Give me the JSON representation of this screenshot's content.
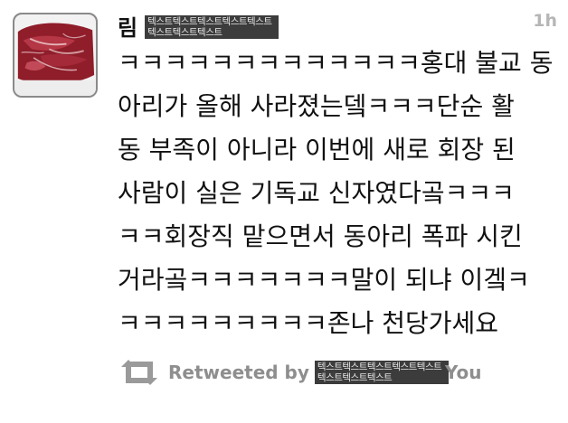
{
  "tweet": {
    "author": {
      "display_name": "림",
      "redacted_handle": "텍스트텍스트텍스트텍스트텍스트텍스트텍스트텍스트"
    },
    "timestamp": "1h",
    "text_lines": [
      "ㅋㅋㅋㅋㅋㅋㅋㅋㅋㅋㅋㅋㅋ홍대 불교 동",
      "아리가 올해 사라졌는뎈ㅋㅋㅋ단순 활",
      "동 부족이 아니라 이번에 새로 회장 된",
      "사람이 실은 기독교 신자였다곸ㅋㅋㅋ",
      "ㅋㅋ회장직 맡으면서 동아리 폭파 시킨",
      "거라곸ㅋㅋㅋㅋㅋㅋㅋ말이 되냐 이겤ㅋ",
      "ㅋㅋㅋㅋㅋㅋㅋㅋㅋ존나 천당가세요"
    ],
    "retweet": {
      "label": "Retweeted by",
      "redacted_name": "텍스트텍스트텍스트텍스트텍스트텍스트텍스트텍스트",
      "suffix": "You"
    }
  },
  "colors": {
    "timestamp": "#b6b6b6",
    "retweet_text": "#8e8e8e",
    "redaction_bg": "#3c3c3c"
  },
  "icons": {
    "avatar": "meat-photo-avatar",
    "retweet": "retweet-icon"
  }
}
